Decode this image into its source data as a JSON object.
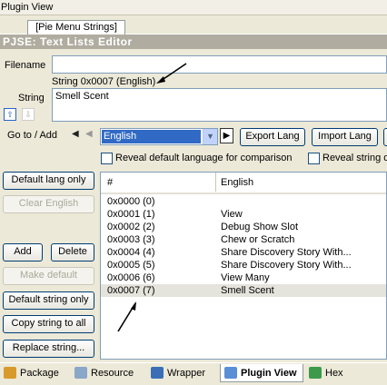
{
  "window": {
    "title": "Plugin View"
  },
  "doc_tab": {
    "label": "[Pie Menu Strings]"
  },
  "editor": {
    "header": "PJSE: Text Lists Editor",
    "filename_label": "Filename",
    "filename_value": "",
    "string_caption": "String 0x0007 (English)",
    "string_label": "String",
    "string_value": "Smell Scent"
  },
  "goto": {
    "label": "Go to / Add",
    "language": "English",
    "export_label": "Export Lang",
    "import_label": "Import Lang"
  },
  "checks": {
    "reveal_default": "Reveal default language for comparison",
    "reveal_string": "Reveal string d"
  },
  "side_buttons": {
    "default_lang_only": "Default lang only",
    "clear_english": "Clear English",
    "add": "Add",
    "delete": "Delete",
    "make_default": "Make default",
    "default_string_only": "Default string only",
    "copy_string_to_all": "Copy string to all",
    "replace_string": "Replace string..."
  },
  "table": {
    "columns": [
      "#",
      "English"
    ],
    "rows": [
      {
        "id": "0x0000 (0)",
        "text": ""
      },
      {
        "id": "0x0001 (1)",
        "text": "View"
      },
      {
        "id": "0x0002 (2)",
        "text": "Debug Show Slot"
      },
      {
        "id": "0x0003 (3)",
        "text": "Chew or Scratch"
      },
      {
        "id": "0x0004 (4)",
        "text": "Share Discovery Story With..."
      },
      {
        "id": "0x0005 (5)",
        "text": "Share Discovery Story With..."
      },
      {
        "id": "0x0006 (6)",
        "text": "View Many"
      },
      {
        "id": "0x0007 (7)",
        "text": "Smell Scent"
      }
    ],
    "selected_index": 7
  },
  "bottom_tabs": [
    {
      "label": "Package",
      "icon": "package-icon"
    },
    {
      "label": "Resource",
      "icon": "resource-icon"
    },
    {
      "label": "Wrapper",
      "icon": "wrapper-icon"
    },
    {
      "label": "Plugin View",
      "icon": "plugin-view-icon"
    },
    {
      "label": "Hex",
      "icon": "hex-icon"
    }
  ]
}
